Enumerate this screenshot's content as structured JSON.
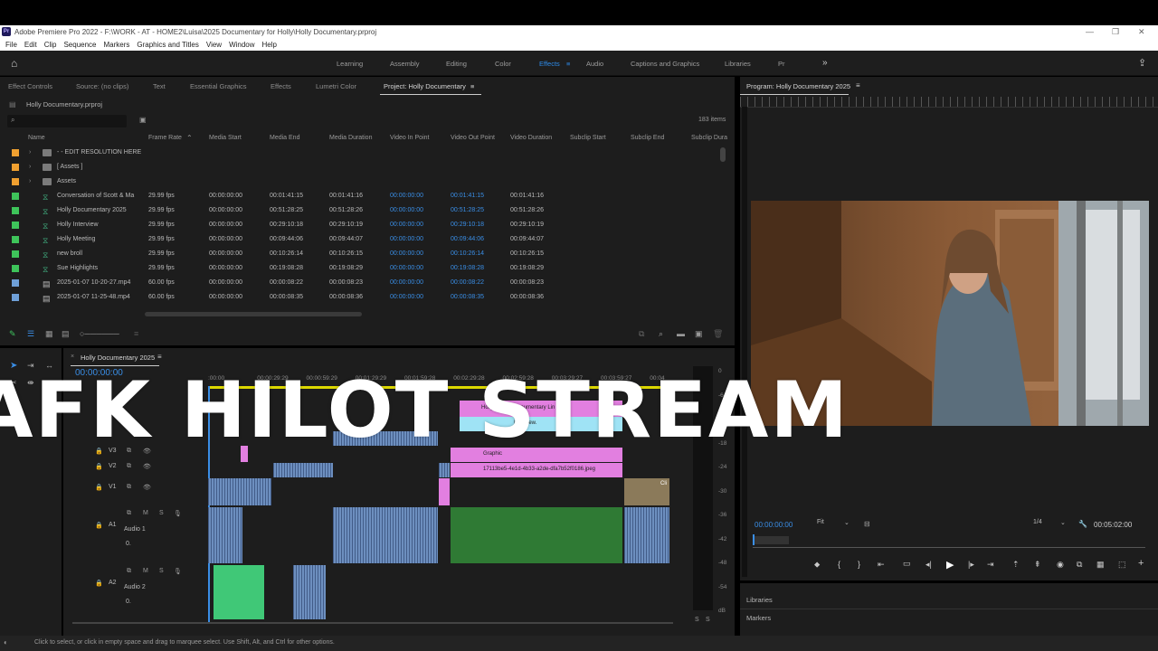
{
  "window": {
    "title": "Adobe Premiere Pro 2022 - F:\\WORK - AT - HOME2\\Luisa\\2025 Documentary for Holly\\Holly Documentary.prproj",
    "app_icon": "Pr"
  },
  "menu": [
    "File",
    "Edit",
    "Clip",
    "Sequence",
    "Markers",
    "Graphics and Titles",
    "View",
    "Window",
    "Help"
  ],
  "workspaces": [
    "Learning",
    "Assembly",
    "Editing",
    "Color",
    "Effects",
    "Audio",
    "Captions and Graphics",
    "Libraries",
    "Pr"
  ],
  "active_workspace": "Effects",
  "panel_tabs": [
    "Effect Controls",
    "Source: (no clips)",
    "Text",
    "Essential Graphics",
    "Effects",
    "Lumetri Color",
    "Project: Holly Documentary"
  ],
  "project": {
    "file": "Holly Documentary.prproj",
    "item_count": "183 items",
    "columns": [
      "Name",
      "Frame Rate",
      "Media Start",
      "Media End",
      "Media Duration",
      "Video In Point",
      "Video Out Point",
      "Video Duration",
      "Subclip Start",
      "Subclip End",
      "Subclip Dura"
    ],
    "rows": [
      {
        "label": "#f0a030",
        "type": "folder",
        "name": "- - EDIT RESOLUTION HERE",
        "fr": "",
        "ms": "",
        "me": "",
        "md": "",
        "vin": "",
        "vout": "",
        "vd": ""
      },
      {
        "label": "#f0a030",
        "type": "folder",
        "name": "[ Assets ]",
        "fr": "",
        "ms": "",
        "me": "",
        "md": "",
        "vin": "",
        "vout": "",
        "vd": ""
      },
      {
        "label": "#f0a030",
        "type": "folder",
        "name": "Assets",
        "fr": "",
        "ms": "",
        "me": "",
        "md": "",
        "vin": "",
        "vout": "",
        "vd": ""
      },
      {
        "label": "#3ec45a",
        "type": "seq",
        "name": "Conversation of Scott & Ma",
        "fr": "29.99 fps",
        "ms": "00:00:00:00",
        "me": "00:01:41:15",
        "md": "00:01:41:16",
        "vin": "00:00:00:00",
        "vout": "00:01:41:15",
        "vd": "00:01:41:16"
      },
      {
        "label": "#3ec45a",
        "type": "seq",
        "name": "Holly Documentary 2025",
        "fr": "29.99 fps",
        "ms": "00:00:00:00",
        "me": "00:51:28:25",
        "md": "00:51:28:26",
        "vin": "00:00:00:00",
        "vout": "00:51:28:25",
        "vd": "00:51:28:26"
      },
      {
        "label": "#3ec45a",
        "type": "seq",
        "name": "Holly Interview",
        "fr": "29.99 fps",
        "ms": "00:00:00:00",
        "me": "00:29:10:18",
        "md": "00:29:10:19",
        "vin": "00:00:00:00",
        "vout": "00:29:10:18",
        "vd": "00:29:10:19"
      },
      {
        "label": "#3ec45a",
        "type": "seq",
        "name": "Holly Meeting",
        "fr": "29.99 fps",
        "ms": "00:00:00:00",
        "me": "00:09:44:06",
        "md": "00:09:44:07",
        "vin": "00:00:00:00",
        "vout": "00:09:44:06",
        "vd": "00:09:44:07"
      },
      {
        "label": "#3ec45a",
        "type": "seq",
        "name": "new broll",
        "fr": "29.99 fps",
        "ms": "00:00:00:00",
        "me": "00:10:26:14",
        "md": "00:10:26:15",
        "vin": "00:00:00:00",
        "vout": "00:10:26:14",
        "vd": "00:10:26:15"
      },
      {
        "label": "#3ec45a",
        "type": "seq",
        "name": "Sue Highlights",
        "fr": "29.99 fps",
        "ms": "00:00:00:00",
        "me": "00:19:08:28",
        "md": "00:19:08:29",
        "vin": "00:00:00:00",
        "vout": "00:19:08:28",
        "vd": "00:19:08:29"
      },
      {
        "label": "#6fa0d8",
        "type": "file",
        "name": "2025-01-07 10-20-27.mp4",
        "fr": "60.00 fps",
        "ms": "00:00:00:00",
        "me": "00:00:08:22",
        "md": "00:00:08:23",
        "vin": "00:00:00:00",
        "vout": "00:00:08:22",
        "vd": "00:00:08:23"
      },
      {
        "label": "#6fa0d8",
        "type": "file",
        "name": "2025-01-07 11-25-48.mp4",
        "fr": "60.00 fps",
        "ms": "00:00:00:00",
        "me": "00:00:08:35",
        "md": "00:00:08:36",
        "vin": "00:00:00:00",
        "vout": "00:00:08:35",
        "vd": "00:00:08:36"
      }
    ]
  },
  "program": {
    "title": "Program: Holly Documentary 2025",
    "timecode": "00:00:00:00",
    "fit": "Fit",
    "resolution": "1/4",
    "duration": "00:05:02:00"
  },
  "timeline": {
    "sequence": "Holly Documentary 2025",
    "timecode": "00:00:00:00",
    "ruler": [
      ":00:00",
      "00:00:29:29",
      "00:00:59:29",
      "00:01:29:29",
      "00:01:59:28",
      "00:02:29:28",
      "00:02:59:28",
      "00:03:29:27",
      "00:03:59:27",
      "00:04"
    ],
    "video_tracks": [
      "V3",
      "V2",
      "V1"
    ],
    "audio_tracks": [
      {
        "id": "A1",
        "name": "Audio 1",
        "vol": "0."
      },
      {
        "id": "A2",
        "name": "Audio 2",
        "vol": "0."
      }
    ],
    "clip_labels": {
      "holly": "Holly",
      "doc": "Documentary Lin",
      "interview": "Interview.",
      "graphic": "Graphic",
      "jpeg": "17113be5-4e1d-4b33-a2de-dfa7b52f0186.jpeg",
      "cli": "Cli"
    },
    "meter_scale": [
      "0",
      "-6",
      "-12",
      "-18",
      "-24",
      "-30",
      "-36",
      "-42",
      "-48",
      "-54",
      "dB"
    ],
    "solo": "S"
  },
  "right_panels": [
    "Libraries",
    "Markers"
  ],
  "status": "Click to select, or click in empty space and drag to marquee select. Use Shift, Alt, and Ctrl for other options.",
  "overlay_text": "AFK HILOT STREAM",
  "colors": {
    "accent": "#2d8ceb",
    "panel": "#1d1d1d",
    "clip_pink": "#e27fe0",
    "clip_green": "#2f7a34",
    "clip_audio": "#6d8fbf"
  }
}
